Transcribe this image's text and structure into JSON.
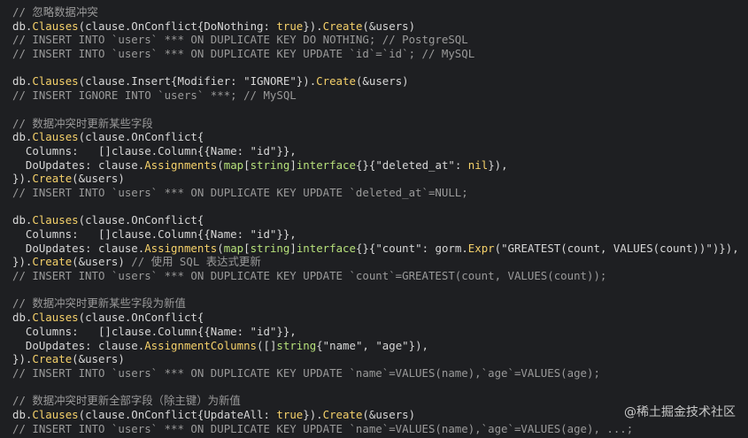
{
  "code": {
    "lines": [
      "// 忽略数据冲突",
      "db.Clauses(clause.OnConflict{DoNothing: true}).Create(&users)",
      "// INSERT INTO `users` *** ON DUPLICATE KEY DO NOTHING; // PostgreSQL",
      "// INSERT INTO `users` *** ON DUPLICATE KEY UPDATE `id`=`id`; // MySQL",
      "",
      "db.Clauses(clause.Insert{Modifier: \"IGNORE\"}).Create(&users)",
      "// INSERT IGNORE INTO `users` ***; // MySQL",
      "",
      "// 数据冲突时更新某些字段",
      "db.Clauses(clause.OnConflict{",
      "  Columns:   []clause.Column{{Name: \"id\"}},",
      "  DoUpdates: clause.Assignments(map[string]interface{}{\"deleted_at\": nil}),",
      "}).Create(&users)",
      "// INSERT INTO `users` *** ON DUPLICATE KEY UPDATE `deleted_at`=NULL;",
      "",
      "db.Clauses(clause.OnConflict{",
      "  Columns:   []clause.Column{{Name: \"id\"}},",
      "  DoUpdates: clause.Assignments(map[string]interface{}{\"count\": gorm.Expr(\"GREATEST(count, VALUES(count))\")}),",
      "}).Create(&users) // 使用 SQL 表达式更新",
      "// INSERT INTO `users` *** ON DUPLICATE KEY UPDATE `count`=GREATEST(count, VALUES(count));",
      "",
      "// 数据冲突时更新某些字段为新值",
      "db.Clauses(clause.OnConflict{",
      "  Columns:   []clause.Column{{Name: \"id\"}},",
      "  DoUpdates: clause.AssignmentColumns([]string{\"name\", \"age\"}),",
      "}).Create(&users)",
      "// INSERT INTO `users` *** ON DUPLICATE KEY UPDATE `name`=VALUES(name),`age`=VALUES(age);",
      "",
      "// 数据冲突时更新全部字段（除主键）为新值",
      "db.Clauses(clause.OnConflict{UpdateAll: true}).Create(&users)",
      "// INSERT INTO `users` *** ON DUPLICATE KEY UPDATE `name`=VALUES(name),`age`=VALUES(age), ...;"
    ]
  },
  "watermark": "@稀土掘金技术社区",
  "colors": {
    "background": "#1e1f22",
    "comment": "#9a9a9a",
    "call": "#f5d16a",
    "text": "#d7d7d7"
  }
}
